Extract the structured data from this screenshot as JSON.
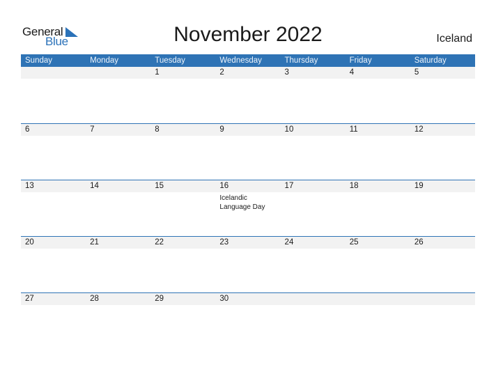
{
  "logo": {
    "text_general": "General",
    "text_blue": "Blue"
  },
  "title": "November 2022",
  "country": "Iceland",
  "colors": {
    "accent": "#2e73b5",
    "date_strip": "#f2f2f2"
  },
  "weekdays": [
    "Sunday",
    "Monday",
    "Tuesday",
    "Wednesday",
    "Thursday",
    "Friday",
    "Saturday"
  ],
  "weeks": [
    {
      "days": [
        "",
        "",
        "1",
        "2",
        "3",
        "4",
        "5"
      ],
      "events": [
        "",
        "",
        "",
        "",
        "",
        "",
        ""
      ]
    },
    {
      "days": [
        "6",
        "7",
        "8",
        "9",
        "10",
        "11",
        "12"
      ],
      "events": [
        "",
        "",
        "",
        "",
        "",
        "",
        ""
      ]
    },
    {
      "days": [
        "13",
        "14",
        "15",
        "16",
        "17",
        "18",
        "19"
      ],
      "events": [
        "",
        "",
        "",
        "Icelandic Language Day",
        "",
        "",
        ""
      ]
    },
    {
      "days": [
        "20",
        "21",
        "22",
        "23",
        "24",
        "25",
        "26"
      ],
      "events": [
        "",
        "",
        "",
        "",
        "",
        "",
        ""
      ]
    },
    {
      "days": [
        "27",
        "28",
        "29",
        "30",
        "",
        "",
        ""
      ],
      "events": [
        "",
        "",
        "",
        "",
        "",
        "",
        ""
      ]
    }
  ]
}
